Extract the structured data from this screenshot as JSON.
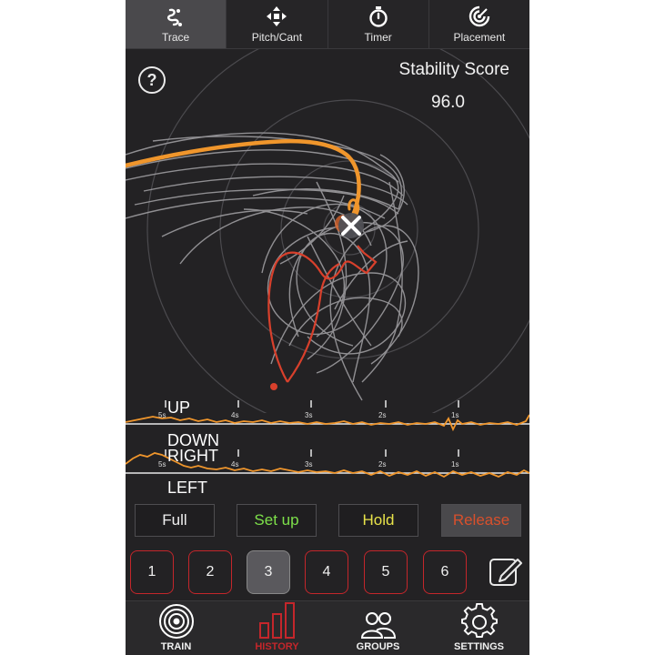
{
  "tabs": [
    {
      "label": "Trace",
      "icon": "trace-icon",
      "active": true
    },
    {
      "label": "Pitch/Cant",
      "icon": "crosshair-arrows-icon",
      "active": false
    },
    {
      "label": "Timer",
      "icon": "stopwatch-icon",
      "active": false
    },
    {
      "label": "Placement",
      "icon": "target-icon",
      "active": false
    }
  ],
  "help": {
    "label": "?"
  },
  "score": {
    "label": "Stability Score",
    "value": "96.0"
  },
  "graphs": {
    "vertical": {
      "top_label": "UP",
      "bottom_label": "DOWN"
    },
    "horizontal": {
      "top_label": "RIGHT",
      "bottom_label": "LEFT"
    },
    "time_ticks": [
      "5s",
      "4s",
      "3s",
      "2s",
      "1s"
    ]
  },
  "phases": [
    {
      "label": "Full",
      "color": "#f0f0f0"
    },
    {
      "label": "Set up",
      "color": "#7de04a"
    },
    {
      "label": "Hold",
      "color": "#e8e34a"
    },
    {
      "label": "Release",
      "color": "#d8502c"
    }
  ],
  "shots": [
    "1",
    "2",
    "3",
    "4",
    "5",
    "6"
  ],
  "selected_shot": "3",
  "nav": [
    {
      "label": "TRAIN",
      "icon": "target-rings-icon",
      "active": false
    },
    {
      "label": "HISTORY",
      "icon": "bar-chart-icon",
      "active": true
    },
    {
      "label": "GROUPS",
      "icon": "people-icon",
      "active": false
    },
    {
      "label": "SETTINGS",
      "icon": "gear-icon",
      "active": false
    }
  ],
  "colors": {
    "accent": "#f0962c",
    "brand_red": "#c4262b",
    "background": "#232224"
  }
}
